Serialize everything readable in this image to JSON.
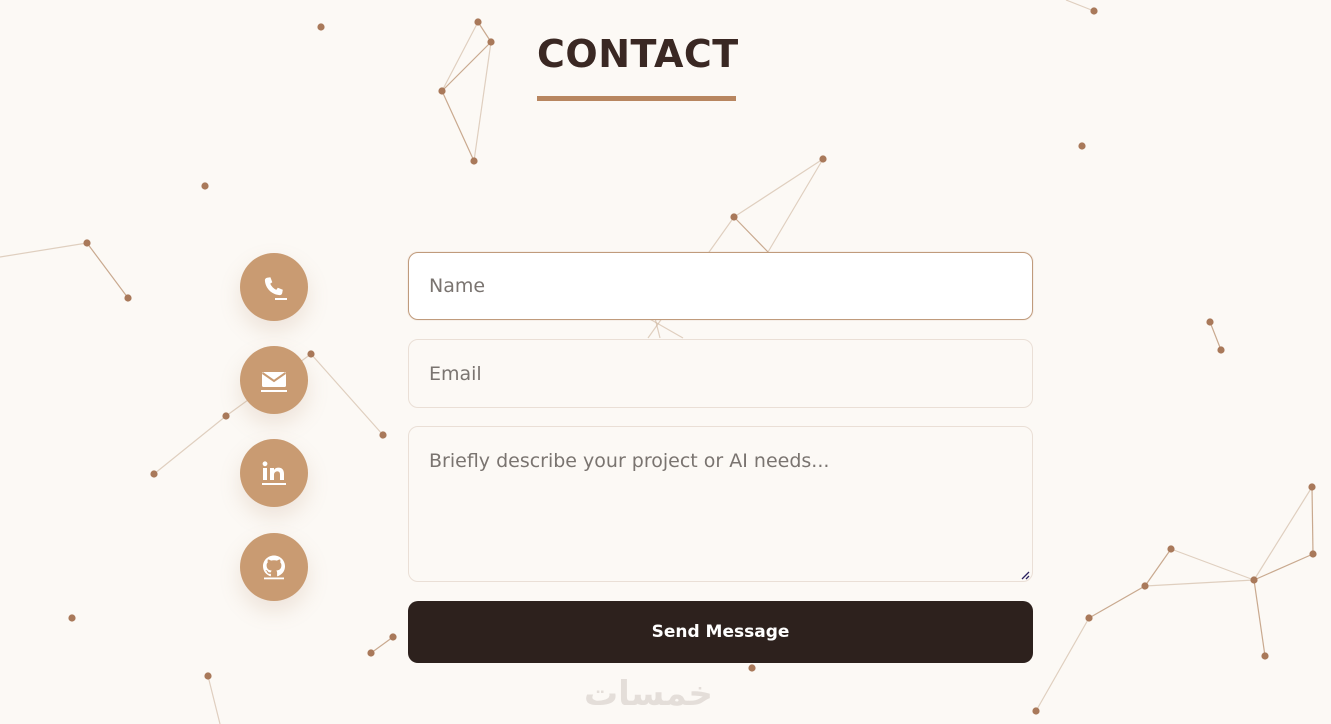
{
  "contact": {
    "title": "CONTACT"
  },
  "social": {
    "items": [
      {
        "icon": "phone-icon"
      },
      {
        "icon": "email-icon"
      },
      {
        "icon": "linkedin-icon"
      },
      {
        "icon": "github-icon"
      }
    ]
  },
  "form": {
    "name_placeholder": "Name",
    "email_placeholder": "Email",
    "message_placeholder": "Briefly describe your project or AI needs...",
    "submit_label": "Send Message"
  },
  "watermark": {
    "text": "خمسات"
  },
  "colors": {
    "background": "#fcf9f5",
    "accent": "#c99b72",
    "title": "#3a2823",
    "button": "#2d211d"
  }
}
